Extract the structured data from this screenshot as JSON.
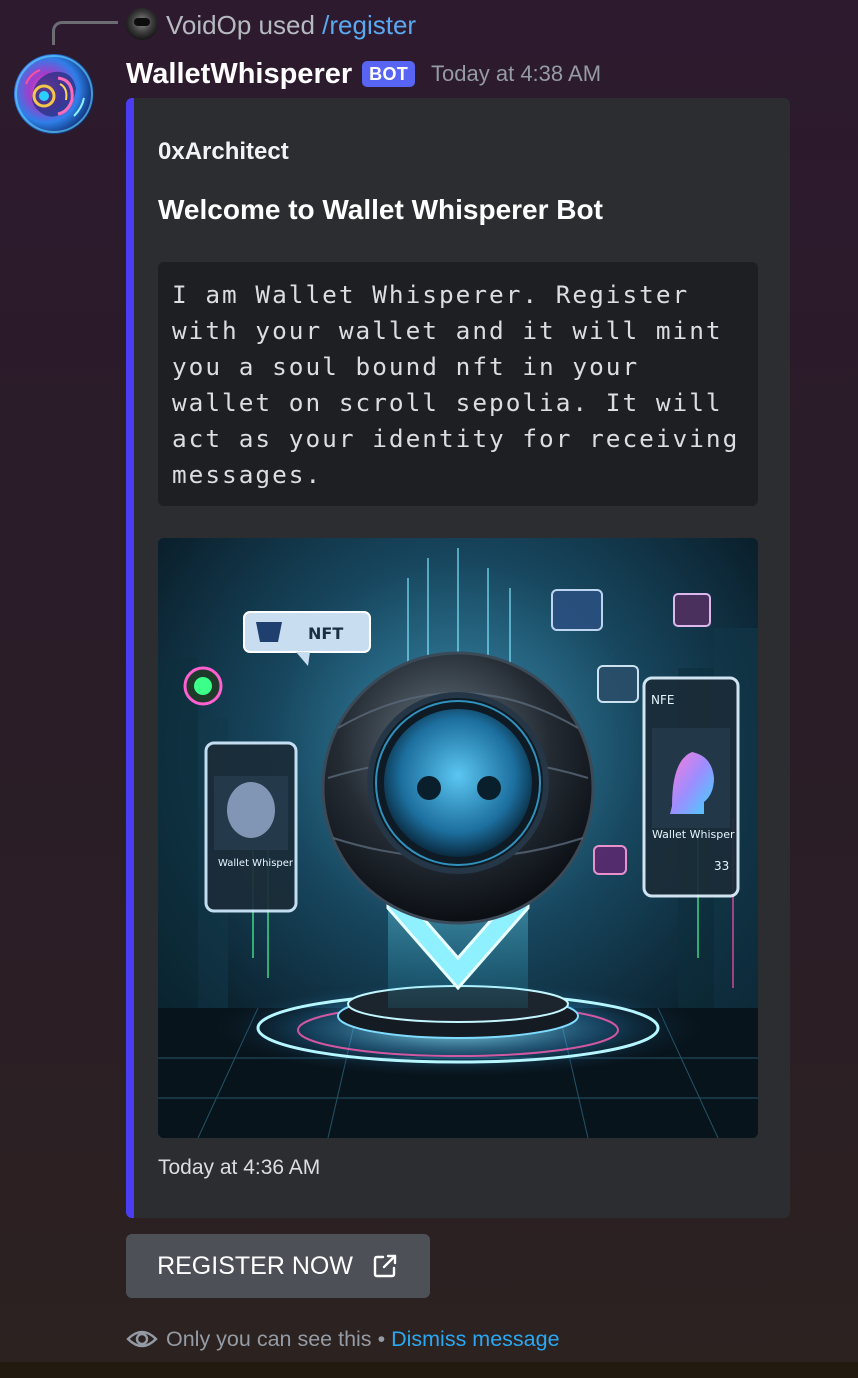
{
  "reply": {
    "username": "VoidOp",
    "action_text": "used",
    "command": "/register",
    "avatar_icon": "reply-user-avatar"
  },
  "message": {
    "author": "WalletWhisperer",
    "bot_tag": "BOT",
    "timestamp": "Today at 4:38 AM",
    "avatar_icon": "bot-avatar"
  },
  "embed": {
    "accent_color": "#4b3df2",
    "author": "0xArchitect",
    "title": "Welcome to Wallet Whisperer Bot",
    "description": "I am Wallet Whisperer. Register with your wallet and it will mint you a soul bound nft in your wallet on scroll sepolia. It will act as your identity for receiving messages.",
    "image": {
      "badge_nft": "NFT",
      "card_right_header": "NFE",
      "card_right_label": "Wallet Whisper",
      "card_right_number": "33",
      "card_left_label": "Wallet Whisper"
    },
    "footer": "Today at 4:36 AM"
  },
  "button": {
    "label": "REGISTER NOW",
    "icon": "external-link-icon"
  },
  "ephemeral": {
    "notice": "Only you can see this",
    "separator": "•",
    "dismiss_label": "Dismiss message",
    "icon": "eye-icon"
  }
}
